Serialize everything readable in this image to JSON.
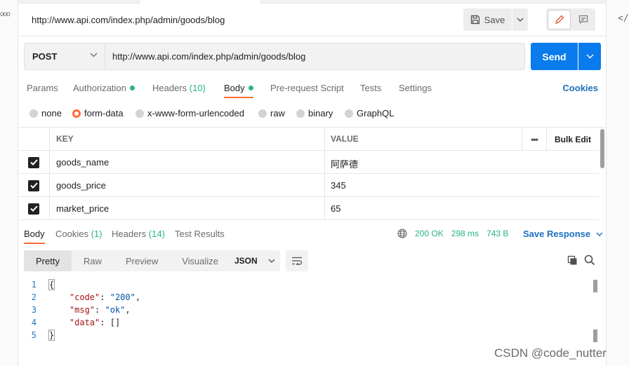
{
  "request": {
    "title": "http://www.api.com/index.php/admin/goods/blog",
    "save_label": "Save",
    "method": "POST",
    "url": "http://www.api.com/index.php/admin/goods/blog",
    "send_label": "Send",
    "tabs": [
      {
        "label": "Params",
        "count": "",
        "dot": false
      },
      {
        "label": "Authorization",
        "count": "",
        "dot": true
      },
      {
        "label": "Headers",
        "count": "(10)",
        "dot": false
      },
      {
        "label": "Body",
        "count": "",
        "dot": true
      },
      {
        "label": "Pre-request Script",
        "count": "",
        "dot": false
      },
      {
        "label": "Tests",
        "count": "",
        "dot": false
      },
      {
        "label": "Settings",
        "count": "",
        "dot": false
      }
    ],
    "active_tab": "Body",
    "cookies_label": "Cookies"
  },
  "body_types": {
    "options": [
      "none",
      "form-data",
      "x-www-form-urlencoded",
      "raw",
      "binary",
      "GraphQL"
    ],
    "selected": "form-data"
  },
  "form_table": {
    "key_header": "KEY",
    "value_header": "VALUE",
    "more_label": "•••",
    "bulk_edit_label": "Bulk Edit",
    "rows": [
      {
        "key": "goods_name",
        "value": "阿萨德",
        "checked": true
      },
      {
        "key": "goods_price",
        "value": "345",
        "checked": true
      },
      {
        "key": "market_price",
        "value": "65",
        "checked": true
      }
    ]
  },
  "response": {
    "tabs": [
      {
        "label": "Body",
        "count": ""
      },
      {
        "label": "Cookies",
        "count": "(1)"
      },
      {
        "label": "Headers",
        "count": "(14)"
      },
      {
        "label": "Test Results",
        "count": ""
      }
    ],
    "active_tab": "Body",
    "status": "200 OK",
    "time": "298 ms",
    "size": "743 B",
    "save_response_label": "Save Response",
    "formats": [
      "Pretty",
      "Raw",
      "Preview",
      "Visualize"
    ],
    "active_format": "Pretty",
    "language": "JSON",
    "lines": [
      {
        "n": "1",
        "text": "{"
      },
      {
        "n": "2",
        "key": "\"code\"",
        "value": "\"200\"",
        "trail": ","
      },
      {
        "n": "3",
        "key": "\"msg\"",
        "value": "\"ok\"",
        "trail": ","
      },
      {
        "n": "4",
        "key": "\"data\"",
        "value": "[]",
        "trail": ""
      },
      {
        "n": "5",
        "text": "}"
      }
    ]
  },
  "watermark": "CSDN @code_nutter",
  "colors": {
    "accent_orange": "#ff6c37",
    "send_blue": "#097bed",
    "link_blue": "#1d6fbf",
    "success_green": "#26b47f"
  }
}
